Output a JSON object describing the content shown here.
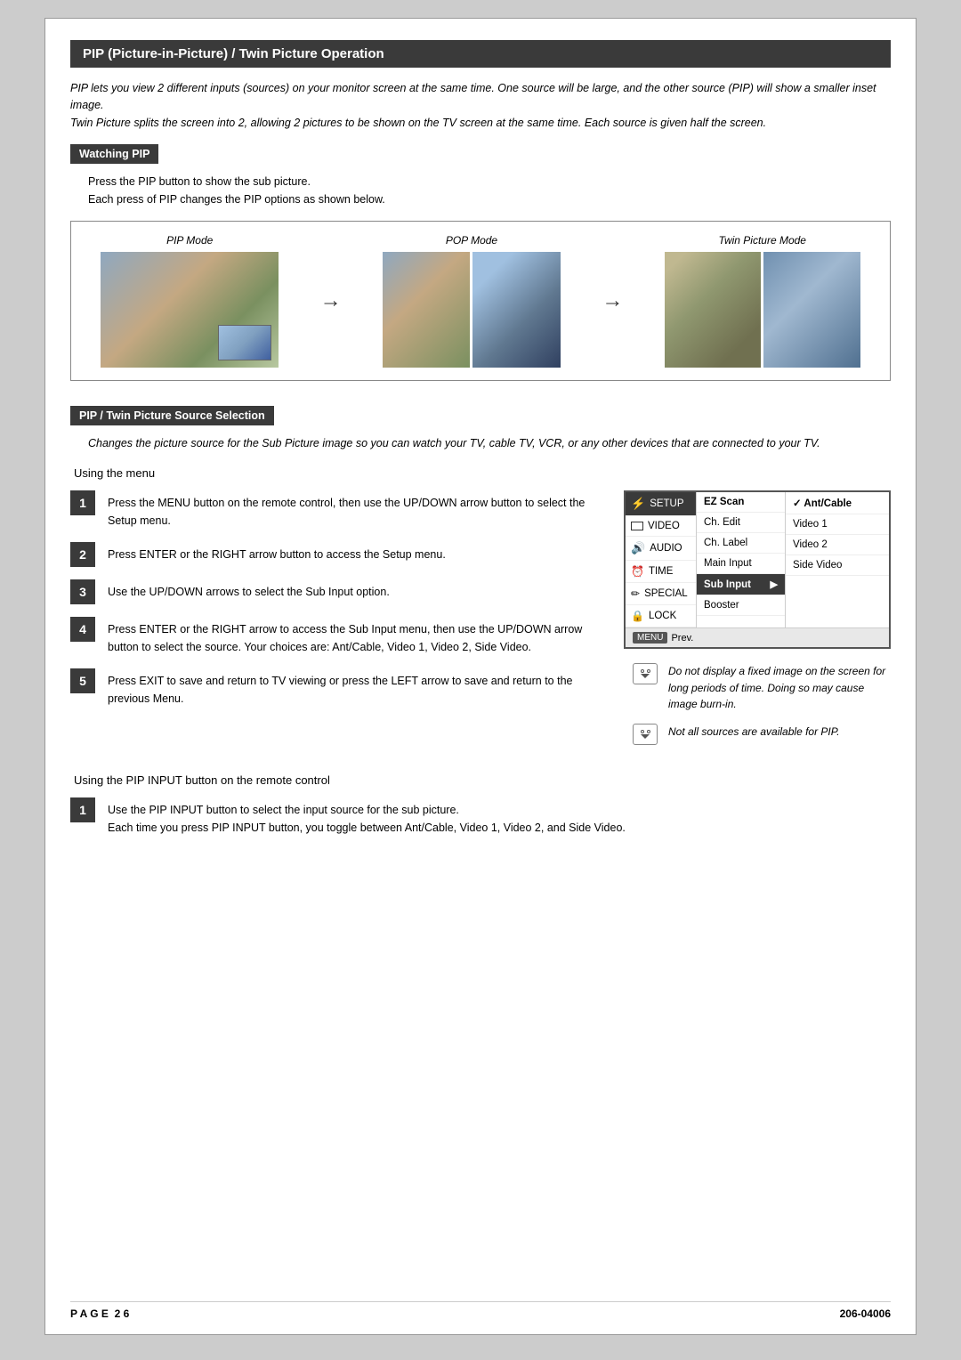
{
  "title": "PIP (Picture-in-Picture) / Twin Picture Operation",
  "intro": {
    "line1": "PIP lets you view 2 different inputs (sources) on your monitor screen at the same time. One source will be large, and the other source (PIP) will show a smaller inset image.",
    "line2": "Twin Picture splits the screen into 2, allowing 2 pictures to be shown on the TV screen at the same time. Each source is given half the screen."
  },
  "watching_pip": {
    "header": "Watching PIP",
    "desc_line1": "Press the PIP button to show the sub picture.",
    "desc_line2": "Each press of PIP changes the PIP options as shown below.",
    "pip_mode_label": "PIP Mode",
    "pop_mode_label": "POP Mode",
    "twin_mode_label": "Twin Picture Mode"
  },
  "source_selection": {
    "header": "PIP / Twin Picture Source Selection",
    "desc": "Changes the picture source for the Sub Picture image so you can watch your TV, cable TV, VCR, or any other devices that are connected to your TV.",
    "using_menu_label": "Using the menu",
    "steps": [
      {
        "num": "1",
        "text": "Press the MENU button on the remote control, then use the UP/DOWN arrow button to select the Setup menu."
      },
      {
        "num": "2",
        "text": "Press ENTER or the RIGHT arrow button to access the Setup menu."
      },
      {
        "num": "3",
        "text": "Use the UP/DOWN arrows to select the Sub Input option."
      },
      {
        "num": "4",
        "text": "Press ENTER or the RIGHT arrow to access the Sub Input menu, then use the UP/DOWN arrow button to select the source. Your choices are: Ant/Cable, Video 1, Video 2, Side Video."
      },
      {
        "num": "5",
        "text": "Press EXIT to save and return to TV viewing or press the LEFT arrow to save and return to the previous Menu."
      }
    ],
    "tv_menu": {
      "left_items": [
        {
          "label": "SETUP",
          "icon": "setup",
          "highlighted": true
        },
        {
          "label": "VIDEO",
          "icon": "video",
          "highlighted": false
        },
        {
          "label": "AUDIO",
          "icon": "audio",
          "highlighted": false
        },
        {
          "label": "TIME",
          "icon": "time",
          "highlighted": false
        },
        {
          "label": "SPECIAL",
          "icon": "special",
          "highlighted": false
        },
        {
          "label": "LOCK",
          "icon": "lock",
          "highlighted": false
        }
      ],
      "center_items": [
        {
          "label": "EZ Scan",
          "highlighted": false,
          "bold": true
        },
        {
          "label": "Ch. Edit",
          "highlighted": false,
          "bold": false
        },
        {
          "label": "Ch. Label",
          "highlighted": false,
          "bold": false
        },
        {
          "label": "Main Input",
          "highlighted": false,
          "bold": false
        },
        {
          "label": "Sub Input",
          "highlighted": true,
          "bold": false,
          "has_arrow": true
        },
        {
          "label": "Booster",
          "highlighted": false,
          "bold": false
        }
      ],
      "right_items": [
        {
          "label": "✓ Ant/Cable",
          "checked": true
        },
        {
          "label": "Video 1",
          "checked": false
        },
        {
          "label": "Video 2",
          "checked": false
        },
        {
          "label": "Side Video",
          "checked": false
        }
      ],
      "bottom_btn": "MENU",
      "bottom_label": "Prev."
    },
    "notes": [
      "Do not display a fixed image on the screen for long periods of time. Doing so may cause image burn-in.",
      "Not all sources are available for PIP."
    ]
  },
  "pip_input_section": {
    "label": "Using the PIP INPUT button on the remote control",
    "steps": [
      {
        "num": "1",
        "text": "Use the PIP INPUT button to select the input source for the sub picture.\nEach time you press PIP INPUT button, you toggle between Ant/Cable, Video 1, Video 2, and Side Video."
      }
    ]
  },
  "footer": {
    "page_label": "P A G E",
    "page_num": "2 6",
    "doc_num": "206-04006"
  }
}
